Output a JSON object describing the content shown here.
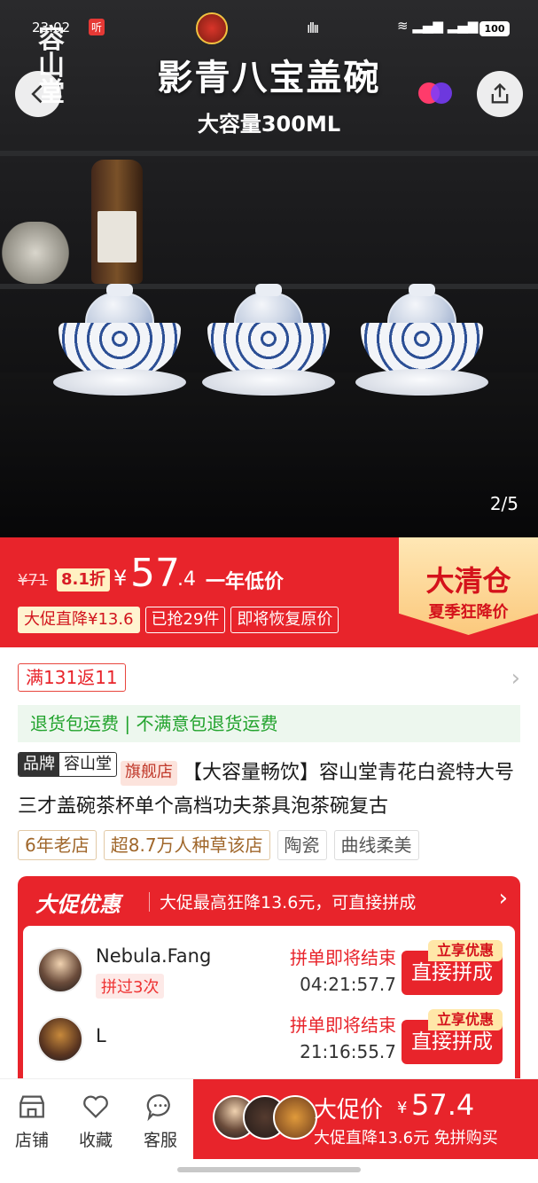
{
  "status_bar": {
    "time": "23:02",
    "listen_badge": "听",
    "battery": "100",
    "signal": "5G 4G"
  },
  "hero": {
    "title": "影青八宝盖碗",
    "subtitle": "大容量300ML",
    "pager": "2/5",
    "logo_text": "容山堂"
  },
  "price": {
    "original": "¥71",
    "discount": "8.1折",
    "currency": "¥",
    "integer": "57",
    "decimal": ".4",
    "low_label": "一年低价",
    "tags": [
      "大促直降¥13.6",
      "已抢29件",
      "即将恢复原价"
    ],
    "clearance_main": "大清仓",
    "clearance_sub": "夏季狂降价"
  },
  "detail": {
    "coupon": "满131返11",
    "return_text": "退货包运费 | 不满意包退货运费",
    "brand_label": "品牌",
    "brand_name": "容山堂",
    "flagship": "旗舰店",
    "title": "【大容量畅饮】容山堂青花白瓷特大号三才盖碗茶杯单个高档功夫茶具泡茶碗复古",
    "chips": [
      "6年老店",
      "超8.7万人种草该店",
      "陶瓷",
      "曲线柔美"
    ]
  },
  "promo": {
    "title": "大促优惠",
    "desc": "大促最高狂降13.6元，可直接拼成",
    "groups": [
      {
        "name": "Nebula.Fang",
        "times": "拼过3次",
        "ending": "拼单即将结束",
        "countdown": "04:21:57.7",
        "ribbon": "立享优惠",
        "button": "直接拼成"
      },
      {
        "name": "L",
        "times": "",
        "ending": "拼单即将结束",
        "countdown": "21:16:55.7",
        "ribbon": "立享优惠",
        "button": "直接拼成"
      }
    ]
  },
  "bottom_bar": {
    "store": "店铺",
    "favorite": "收藏",
    "service": "客服",
    "buy_label": "大促价",
    "buy_currency": "¥",
    "buy_price": "57.4",
    "buy_sub": "大促直降13.6元 免拼购买"
  },
  "colors": {
    "accent": "#e8242b",
    "green": "#22a32d"
  }
}
